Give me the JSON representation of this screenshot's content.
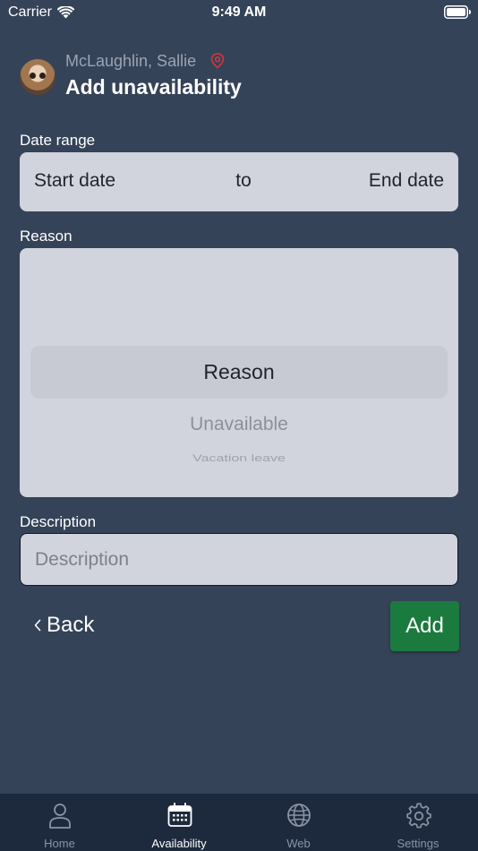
{
  "status_bar": {
    "carrier": "Carrier",
    "time": "9:49 AM",
    "wifi_icon": "wifi-icon",
    "battery_icon": "battery-icon"
  },
  "header": {
    "user_name": "McLaughlin, Sallie",
    "title": "Add unavailability",
    "avatar_icon": "avatar",
    "location_icon": "location-pin-icon",
    "location_icon_color": "#d9343a"
  },
  "date_range": {
    "label": "Date range",
    "start": "Start date",
    "separator": "to",
    "end": "End date"
  },
  "reason": {
    "label": "Reason",
    "selected": "Reason",
    "options": [
      "Unavailable",
      "Vacation leave"
    ]
  },
  "description": {
    "label": "Description",
    "placeholder": "Description",
    "value": ""
  },
  "actions": {
    "back_label": "Back",
    "add_label": "Add",
    "add_color": "#1b7a3e"
  },
  "tab_bar": {
    "active": "Availability",
    "tabs": [
      {
        "label": "Home",
        "icon": "person-icon"
      },
      {
        "label": "Availability",
        "icon": "calendar-icon"
      },
      {
        "label": "Web",
        "icon": "globe-icon"
      },
      {
        "label": "Settings",
        "icon": "gear-icon"
      }
    ]
  },
  "colors": {
    "background": "#354358",
    "tab_bar": "#1d2a3e",
    "field": "#d1d4dc"
  }
}
